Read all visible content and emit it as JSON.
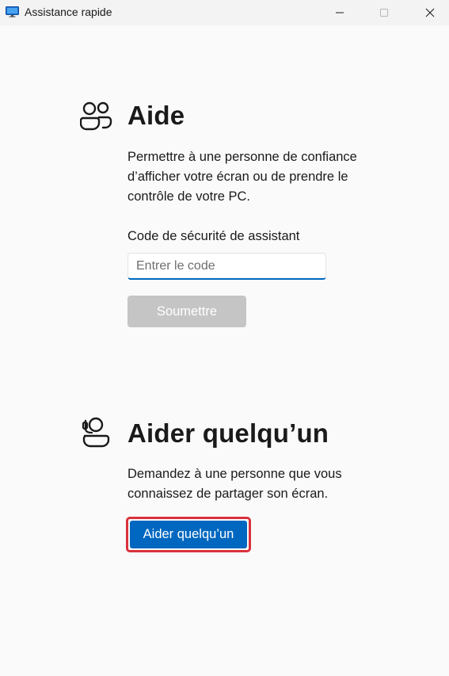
{
  "window": {
    "title": "Assistance rapide",
    "icon": "quick-assist-monitor-icon"
  },
  "controls": {
    "minimize_icon": "minimize-icon",
    "maximize_icon": "maximize-icon",
    "close_icon": "close-icon"
  },
  "get_help": {
    "icon": "people-icon",
    "heading": "Aide",
    "description_lines": [
      "Permettre à une personne de confiance",
      "d’afficher votre écran ou de prendre le",
      "contrôle de votre PC."
    ],
    "code_label": "Code de sécurité de assistant",
    "code_placeholder": "Entrer le code",
    "code_value": "",
    "submit_label": "Soumettre"
  },
  "give_help": {
    "icon": "person-headset-icon",
    "heading": "Aider quelqu’un",
    "description_lines": [
      "Demandez à une personne que vous",
      "connaissez de partager son écran."
    ],
    "button_label": "Aider quelqu’un"
  },
  "colors": {
    "accent": "#0067c0",
    "disabled_button": "#c5c5c5",
    "highlight_border": "#d9313d",
    "background": "#fafafa"
  }
}
